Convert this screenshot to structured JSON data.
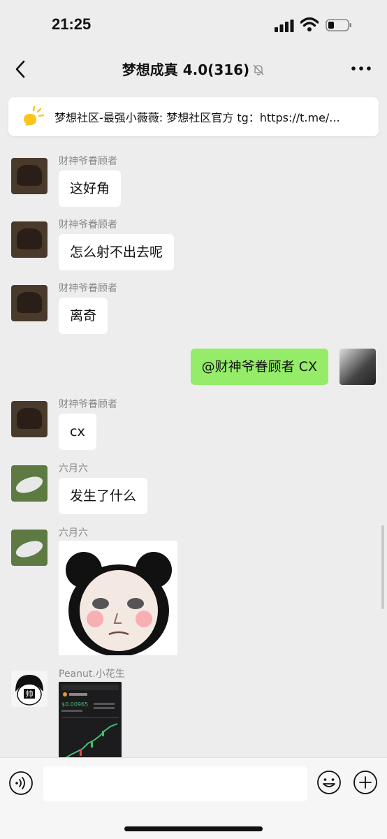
{
  "status": {
    "time": "21:25"
  },
  "nav": {
    "title": "梦想成真 4.0(316)"
  },
  "notice": {
    "text": "梦想社区-最强小薇薇: 梦想社区官方 tg：https://t.me/..."
  },
  "messages": [
    {
      "sender": "财神爷眷顾者",
      "text": "这好角"
    },
    {
      "sender": "财神爷眷顾者",
      "text": "怎么射不出去呢"
    },
    {
      "sender": "财神爷眷顾者",
      "text": "离奇"
    },
    {
      "sender": "财神爷眷顾者",
      "text": "cx"
    },
    {
      "sender": "六月六",
      "text": "发生了什么"
    },
    {
      "sender": "六月六"
    },
    {
      "sender": "Peanut.小花生"
    }
  ],
  "self_message": {
    "text": "@财神爷眷顾者 CX"
  },
  "avatar_peanut": {
    "label": "帅"
  },
  "screenshot": {
    "price": "$0.00965"
  },
  "colors": {
    "self_bubble": "#95ec69",
    "background": "#ededed",
    "notice_icon": "#f7c51e"
  },
  "icons": [
    "back-arrow-icon",
    "bell-muted-icon",
    "more-icon",
    "notice-icon",
    "voice-icon",
    "emoji-icon",
    "plus-icon"
  ]
}
